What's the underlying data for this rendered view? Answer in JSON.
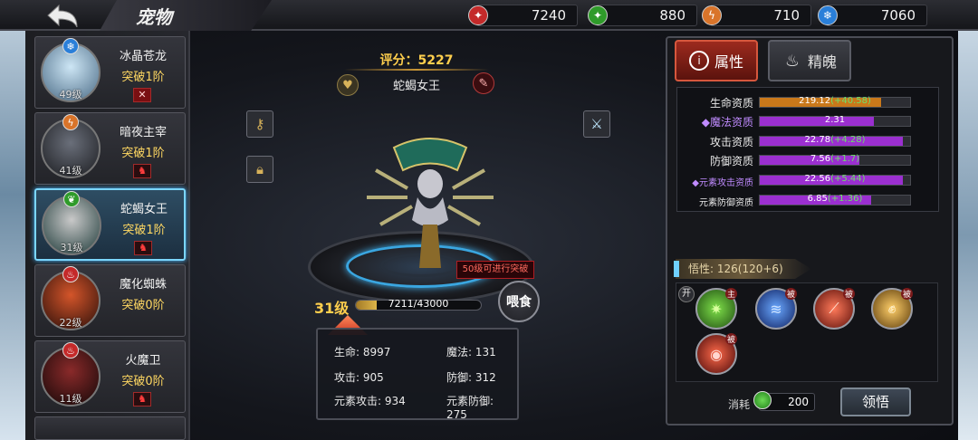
{
  "header": {
    "title": "宠物",
    "back_icon": "back-arrow-icon",
    "resources": [
      {
        "icon": "red-gem-icon",
        "color": "#c42a2a",
        "value": "7240"
      },
      {
        "icon": "green-gem-icon",
        "color": "#2f9b2a",
        "value": "880"
      },
      {
        "icon": "lightning-icon",
        "color": "#d9742a",
        "value": "710"
      },
      {
        "icon": "snowflake-icon",
        "color": "#2a7fd9",
        "value": "7060"
      }
    ]
  },
  "pets": [
    {
      "name": "冰晶苍龙",
      "stage": "突破1阶",
      "level": "49级",
      "element_color": "#2a7fd9",
      "element_icon": "snowflake-icon",
      "selected": false
    },
    {
      "name": "暗夜主宰",
      "stage": "突破1阶",
      "level": "41级",
      "element_color": "#d9742a",
      "element_icon": "lightning-icon",
      "selected": false
    },
    {
      "name": "蛇蝎女王",
      "stage": "突破1阶",
      "level": "31级",
      "element_color": "#2f9b2a",
      "element_icon": "leaf-icon",
      "selected": true
    },
    {
      "name": "魔化蜘蛛",
      "stage": "突破0阶",
      "level": "22级",
      "element_color": "#c42a2a",
      "element_icon": "fire-icon",
      "selected": false
    },
    {
      "name": "火魔卫",
      "stage": "突破0阶",
      "level": "11级",
      "element_color": "#c42a2a",
      "element_icon": "fire-icon",
      "selected": false
    }
  ],
  "center": {
    "score": "评分：5227",
    "pet_name": "蛇蝎女王",
    "level": "31级",
    "exp_text": "7211/43000",
    "exp_fraction": 0.168,
    "hint": "50级可进行突破",
    "feed_label": "喂食",
    "stats": [
      {
        "label": "生命: 8997"
      },
      {
        "label": "魔法: 131"
      },
      {
        "label": "攻击: 905"
      },
      {
        "label": "防御: 312"
      },
      {
        "label": "元素攻击: 934"
      },
      {
        "label": "元素防御: 275"
      }
    ]
  },
  "right_panel": {
    "tabs": [
      {
        "label": "属性",
        "icon": "info-icon",
        "active": true
      },
      {
        "label": "精魄",
        "icon": "flame-icon",
        "active": false
      }
    ],
    "attributes": [
      {
        "label": "生命资质",
        "value": "219.12",
        "bonus": "(+40.58)",
        "fill": 0.81,
        "color": "#c9781a",
        "style": "normal"
      },
      {
        "label": "◆魔法资质",
        "value": "2.31",
        "bonus": "",
        "fill": 0.76,
        "color": "#9b2fd0",
        "style": "purple"
      },
      {
        "label": "攻击资质",
        "value": "22.78",
        "bonus": "(+4.28)",
        "fill": 0.95,
        "color": "#9b2fd0",
        "style": "normal"
      },
      {
        "label": "防御资质",
        "value": "7.56",
        "bonus": "(+1.7)",
        "fill": 0.66,
        "color": "#9b2fd0",
        "style": "normal"
      },
      {
        "label": "◆元素攻击资质",
        "value": "22.56",
        "bonus": "(+5.44)",
        "fill": 0.95,
        "color": "#9b2fd0",
        "style": "purple-small"
      },
      {
        "label": "元素防御资质",
        "value": "6.85",
        "bonus": "(+1.36)",
        "fill": 0.74,
        "color": "#9b2fd0",
        "style": "small"
      }
    ],
    "wisdom": "悟性: 126(120+6)",
    "open_tag": "开",
    "skills": [
      {
        "icon": "green-star-skill-icon",
        "tag": "主",
        "color": "#3c9b24"
      },
      {
        "icon": "blue-claw-skill-icon",
        "tag": "被",
        "color": "#2a4fb5"
      },
      {
        "icon": "red-slash-skill-icon",
        "tag": "被",
        "color": "#b52a2a"
      },
      {
        "icon": "fist-skill-icon",
        "tag": "被",
        "color": "#a3702a"
      },
      {
        "icon": "red-orb-skill-icon",
        "tag": "被",
        "color": "#b52a2a"
      }
    ],
    "cost_label": "消耗",
    "cost_value": "200",
    "learn_label": "领悟"
  }
}
